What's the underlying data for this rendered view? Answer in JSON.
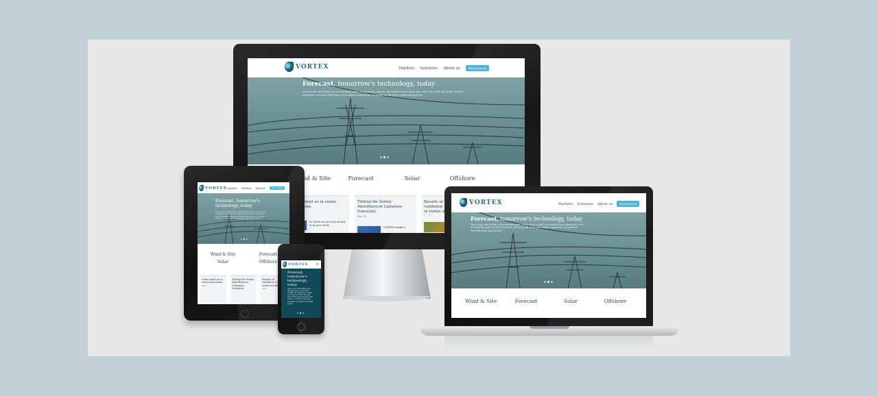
{
  "site": {
    "logo_text": "VORTEX",
    "nav": [
      "Markets",
      "Solutions",
      "About us"
    ],
    "cta": "Wind Search",
    "hero_title_bold": "Forecast",
    "hero_title_rest": ", tomorrow's technology, today",
    "hero_title_short": "Forecast, tomorrow's technology, today",
    "hero_text": "Once your wind farm is an integral part, every hour counts, no matter how many you were at work the past. Vortex Forecast services will show you where tomorrow, seconds or decades wind and power.",
    "categories": [
      "Wind & Site",
      "Forecast",
      "Solar",
      "Offshore"
    ],
    "cards": [
      {
        "title": "Come meet us in sunny Barcelona",
        "date": "Mar 2"
      },
      {
        "title": "Türkiye'de Vortex Akreditasyon Çalışması Sonuçları",
        "date": "Mar 16"
      },
      {
        "title": "Results of validation of vortex in India",
        "date": "Mar 7"
      }
    ],
    "card_snippets": [
      "At Vortex we are very excited to be part of the",
      "VORTEX installs a"
    ]
  },
  "colors": {
    "page_bg": "#c2d1d8",
    "stage_bg": "#e7e7e7",
    "brand": "#2b6d86",
    "cta": "#48b8da",
    "hero_teal": "#6d9294",
    "phone_hero": "#104957"
  },
  "icons": {
    "logo": "vortex-swirl-icon",
    "tower": "power-tower-icon"
  }
}
